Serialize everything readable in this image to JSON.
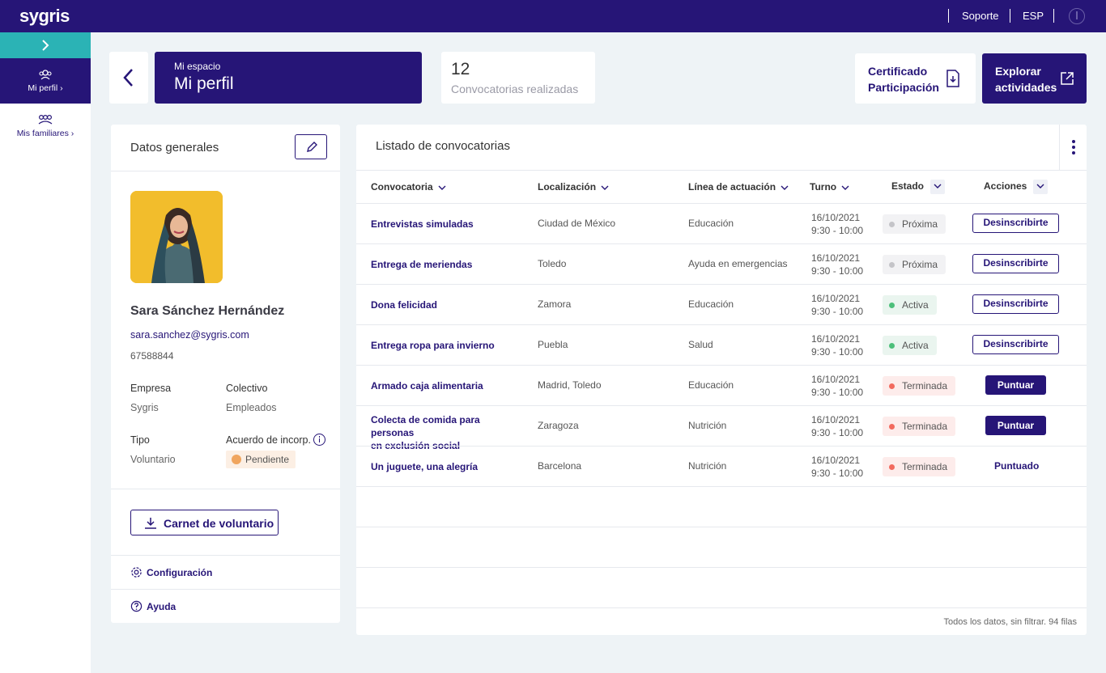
{
  "app": {
    "logo": "sygris",
    "nav": {
      "support": "Soporte",
      "language": "ESP"
    }
  },
  "colors": {
    "brand": "#261577",
    "accent": "#2bb3b5",
    "background": "#eef3f6"
  },
  "sidebar": {
    "items": [
      {
        "label": "Mi perfil",
        "icon": "profile-icon",
        "active": true
      },
      {
        "label": "Mis familiares",
        "icon": "family-icon",
        "active": false
      }
    ]
  },
  "header": {
    "breadcrumb": "Mi espacio",
    "title": "Mi perfil",
    "stat_value": "12",
    "stat_label": "Convocatorias realizadas",
    "cert_line1": "Certificado",
    "cert_line2": "Participación",
    "explore_line1": "Explorar",
    "explore_line2": "actividades"
  },
  "profile": {
    "section_title": "Datos generales",
    "name": "Sara Sánchez Hernández",
    "email": "sara.sanchez@sygris.com",
    "phone": "67588844",
    "fields": {
      "empresa_label": "Empresa",
      "empresa_value": "Sygris",
      "colectivo_label": "Colectivo",
      "colectivo_value": "Empleados",
      "tipo_label": "Tipo",
      "tipo_value": "Voluntario",
      "acuerdo_label": "Acuerdo de incorp.",
      "acuerdo_value": "Pendiente"
    },
    "carnet_button": "Carnet de voluntario",
    "config_link": "Configuración",
    "help_link": "Ayuda"
  },
  "table": {
    "title": "Listado de convocatorias",
    "columns": [
      "Convocatoria",
      "Localización",
      "Línea de actuación",
      "Turno",
      "Estado",
      "Acciones"
    ],
    "rows": [
      {
        "name": "Entrevistas simuladas",
        "location": "Ciudad de México",
        "line": "Educación",
        "date": "16/10/2021",
        "time": "9:30 - 10:00",
        "status": "Próxima",
        "action": "Desinscribirte"
      },
      {
        "name": "Entrega de meriendas",
        "location": "Toledo",
        "line": "Ayuda en emergencias",
        "date": "16/10/2021",
        "time": "9:30 - 10:00",
        "status": "Próxima",
        "action": "Desinscribirte"
      },
      {
        "name": "Dona felicidad",
        "location": "Zamora",
        "line": "Educación",
        "date": "16/10/2021",
        "time": "9:30 - 10:00",
        "status": "Activa",
        "action": "Desinscribirte"
      },
      {
        "name": "Entrega ropa para invierno",
        "location": "Puebla",
        "line": "Salud",
        "date": "16/10/2021",
        "time": "9:30 - 10:00",
        "status": "Activa",
        "action": "Desinscribirte"
      },
      {
        "name": "Armado caja alimentaria",
        "location": "Madrid, Toledo",
        "line": "Educación",
        "date": "16/10/2021",
        "time": "9:30 - 10:00",
        "status": "Terminada",
        "action": "Puntuar"
      },
      {
        "name_line1": "Colecta de comida para personas",
        "name_line2": "en exclusión social",
        "location": "Zaragoza",
        "line": "Nutrición",
        "date": "16/10/2021",
        "time": "9:30 - 10:00",
        "status": "Terminada",
        "action": "Puntuar"
      },
      {
        "name": "Un juguete, una alegría",
        "location": "Barcelona",
        "line": "Nutrición",
        "date": "16/10/2021",
        "time": "9:30 - 10:00",
        "status": "Terminada",
        "action": "Puntuado"
      }
    ],
    "footer": "Todos los datos, sin filtrar. 94 filas"
  }
}
